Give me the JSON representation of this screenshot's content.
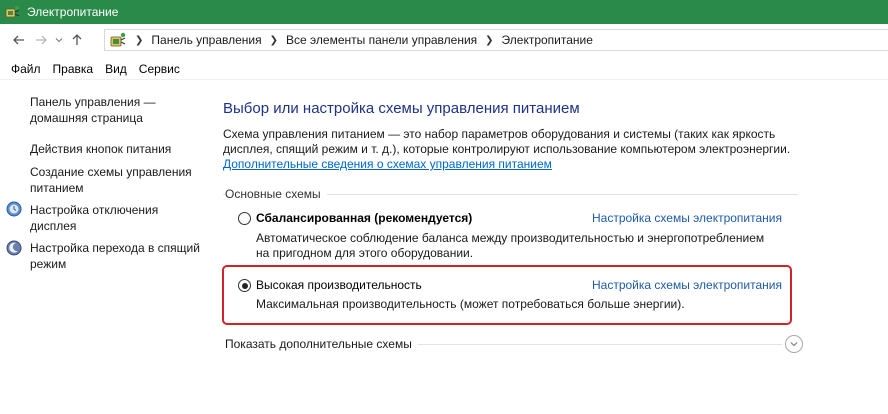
{
  "window": {
    "title": "Электропитание",
    "titlebar_color": "#2a8a4a"
  },
  "navigation": {
    "back_icon": "arrow-left-icon",
    "forward_icon": "arrow-right-icon",
    "recent_icon": "chevron-down-icon",
    "up_icon": "arrow-up-icon"
  },
  "breadcrumb": {
    "items": [
      "Панель управления",
      "Все элементы панели управления",
      "Электропитание"
    ]
  },
  "menu": {
    "items": [
      "Файл",
      "Правка",
      "Вид",
      "Сервис"
    ]
  },
  "sidebar": {
    "items": [
      {
        "label": "Панель управления — домашняя страница",
        "icon": null
      },
      {
        "label": "Действия кнопок питания",
        "icon": null
      },
      {
        "label": "Создание схемы управления питанием",
        "icon": null
      },
      {
        "label": "Настройка отключения дисплея",
        "icon": "display-timer-icon"
      },
      {
        "label": "Настройка перехода в спящий режим",
        "icon": "sleep-moon-icon"
      }
    ]
  },
  "main": {
    "heading": "Выбор или настройка схемы управления питанием",
    "description": "Схема управления питанием — это набор параметров оборудования и системы (таких как яркость дисплея, спящий режим и т. д.), которые контролируют использование компьютером электроэнергии.",
    "more_info_link": "Дополнительные сведения о схемах управления питанием",
    "group_label": "Основные схемы",
    "schemes": [
      {
        "name": "Сбалансированная (рекомендуется)",
        "selected": false,
        "description": "Автоматическое соблюдение баланса между производительностью и энергопотреблением на пригодном для этого оборудовании.",
        "description_lines": [
          "Автоматическое соблюдение баланса между производительностью и энергопотреблением",
          "на пригодном для этого оборудовании."
        ],
        "settings_link": "Настройка схемы электропитания"
      },
      {
        "name": "Высокая производительность",
        "selected": true,
        "description": "Максимальная производительность (может потребоваться больше энергии).",
        "settings_link": "Настройка схемы электропитания"
      }
    ],
    "show_more_label": "Показать дополнительные схемы",
    "highlight_color": "#d2232a",
    "link_color": "#1e5aa8",
    "heading_color": "#1e3287"
  }
}
